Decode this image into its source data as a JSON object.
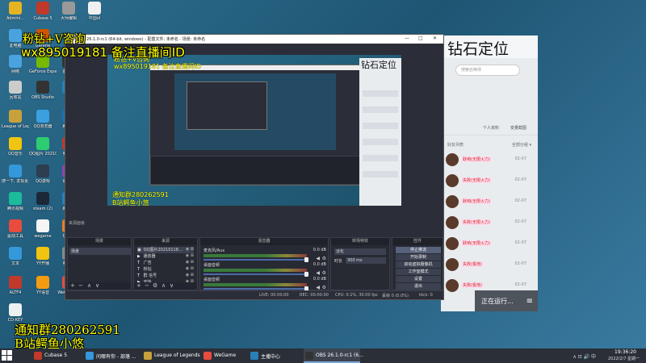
{
  "desktop_icons": [
    {
      "label": "Admini...",
      "color": "#e6b422"
    },
    {
      "label": "Cubase 5",
      "color": "#c0392b"
    },
    {
      "label": "大师编辑",
      "color": "#999999"
    },
    {
      "label": "中国ol",
      "color": "#f0f0f0"
    },
    {
      "label": "此电脑",
      "color": "#4aa3df"
    },
    {
      "label": "Garena",
      "color": "#d35400"
    },
    {
      "label": "网络",
      "color": "#4aa3df"
    },
    {
      "label": "GeForce Experience",
      "color": "#76b900"
    },
    {
      "label": "图像修",
      "color": "#333333"
    },
    {
      "label": "回收站",
      "color": "#cccccc"
    },
    {
      "label": "OBS Studio",
      "color": "#333333"
    },
    {
      "label": "网络",
      "color": "#2980b9"
    },
    {
      "label": "League of Legends",
      "color": "#c8a13c"
    },
    {
      "label": "QQ浏览器",
      "color": "#3aa0e0"
    },
    {
      "label": "腾讯专",
      "color": "#1f6fb5"
    },
    {
      "label": "QQ音乐",
      "color": "#f1c40f"
    },
    {
      "label": "QQ图片 20210118...",
      "color": "#2ecc71"
    },
    {
      "label": "英雄联",
      "color": "#c0392b"
    },
    {
      "label": "搜一下, 发现更多",
      "color": "#3498db"
    },
    {
      "label": "QQ游戏",
      "color": "#2c3e50"
    },
    {
      "label": "德玛西",
      "color": "#8e44ad"
    },
    {
      "label": "腾讯视频",
      "color": "#1abc9c"
    },
    {
      "label": "steam (2)",
      "color": "#1b2838"
    },
    {
      "label": "腾讯电",
      "color": "#2980b9"
    },
    {
      "label": "驱动工具",
      "color": "#e74c3c"
    },
    {
      "label": "wegame",
      "color": "#f5f5f5"
    },
    {
      "label": "玩家主",
      "color": "#e67e22"
    },
    {
      "label": "文本",
      "color": "#3498db"
    },
    {
      "label": "YY开播",
      "color": "#f1c40f"
    },
    {
      "label": "英雄联",
      "color": "#7f8c8d"
    },
    {
      "label": "ALTF4",
      "color": "#c0392b"
    },
    {
      "label": "YY语音",
      "color": "#f39c12"
    },
    {
      "label": "WeGame服",
      "color": "#e74c3c"
    },
    {
      "label": "CD-KEY",
      "color": "#ecf0f1"
    }
  ],
  "overlay": {
    "top_line1": "粉钻+V咨询",
    "top_line2": "wx895019181 备注直播间ID",
    "bottom_line1": "通知群280262591",
    "bottom_line2": "B站鳄鱼小悠"
  },
  "obs": {
    "title": "OBS 26.1.0-rc1 (64-bit, windows) - 配置文件: 未命名 - 场景: 未命名",
    "window_controls": {
      "minimize": "—",
      "maximize": "□",
      "close": "✕"
    },
    "docks": {
      "scenes": {
        "header": "场景",
        "items": [
          "场景"
        ]
      },
      "sources": {
        "header": "来源",
        "items": [
          {
            "name": "QQ图片20210118...",
            "icon": "▣"
          },
          {
            "name": "播放器",
            "icon": "▶"
          },
          {
            "name": "广告",
            "icon": "T"
          },
          {
            "name": "粉钻",
            "icon": "T"
          },
          {
            "name": "群 信号",
            "icon": "T"
          },
          {
            "name": "欢快",
            "icon": "▶"
          }
        ]
      },
      "mixer": {
        "header": "混音器",
        "channels": [
          {
            "name": "麦克风/Aux",
            "db": "0.0 dB"
          },
          {
            "name": "桌面音频",
            "db": "0.0 dB"
          },
          {
            "name": "桌面音频",
            "db": "0.0 dB"
          }
        ]
      },
      "transitions": {
        "header": "转场特效",
        "selected": "淡化",
        "duration_label": "时长",
        "duration": "300 ms"
      },
      "controls": {
        "header": "控件",
        "buttons": [
          "停止推流",
          "开始录制",
          "启动虚拟摄像机",
          "工作室模式",
          "设置",
          "退出"
        ]
      }
    },
    "dock_footer": {
      "add": "+",
      "remove": "−",
      "up": "∧",
      "down": "∨",
      "gear": "⚙"
    },
    "status": {
      "live": "LIVE: 00:00:00",
      "rec": "REC: 00:00:00",
      "cpu": "CPU: 0.1%, 30.00 fps",
      "dropped": "丢帧 0 (0.0%)",
      "kbps": "kb/s: 0"
    },
    "preview_label": "来源面板",
    "nested": {
      "banner": "钻石定位",
      "yellow1": "粉钻+V咨询",
      "yellow2": "wx895019181 备注直播间ID",
      "yellow3": "通知群280262591",
      "yellow4": "B站鳄鱼小悠"
    }
  },
  "client": {
    "banner": "钻石定位",
    "search_placeholder": "搜索召唤师",
    "tabs": [
      "个人资料",
      "变量截图"
    ],
    "header_left": "好友列表",
    "header_right": "全部分组 ▾",
    "friends": [
      {
        "name": "跃响(无限火力)",
        "date": "02-07"
      },
      {
        "name": "失败(无限火力)",
        "date": "02-07"
      },
      {
        "name": "跃响(无限火力)",
        "date": "02-07"
      },
      {
        "name": "失败(无限火力)",
        "date": "02-07"
      },
      {
        "name": "跃响(无限火力)",
        "date": "02-07"
      },
      {
        "name": "失败(极地)",
        "date": "02-07"
      },
      {
        "name": "失败(极地)",
        "date": "02-07"
      }
    ],
    "ingame_label": "正在运行...",
    "ingame_menu": "≡"
  },
  "taskbar": {
    "items": [
      {
        "label": "Cubase 5",
        "color": "#c0392b"
      },
      {
        "label": "问哪有你 - 部落 ...",
        "color": "#3498db"
      },
      {
        "label": "League of Legends",
        "color": "#c8a13c"
      },
      {
        "label": "WeGame",
        "color": "#e74c3c"
      },
      {
        "label": "主播中心",
        "color": "#2980b9"
      },
      {
        "label": "OBS 26.1.0-rc1 (6...",
        "color": "#333333"
      }
    ],
    "tray_icons": "∧ ⊡ 🔊 中",
    "time": "19:36:20",
    "date": "2022/2/7 星期一"
  }
}
